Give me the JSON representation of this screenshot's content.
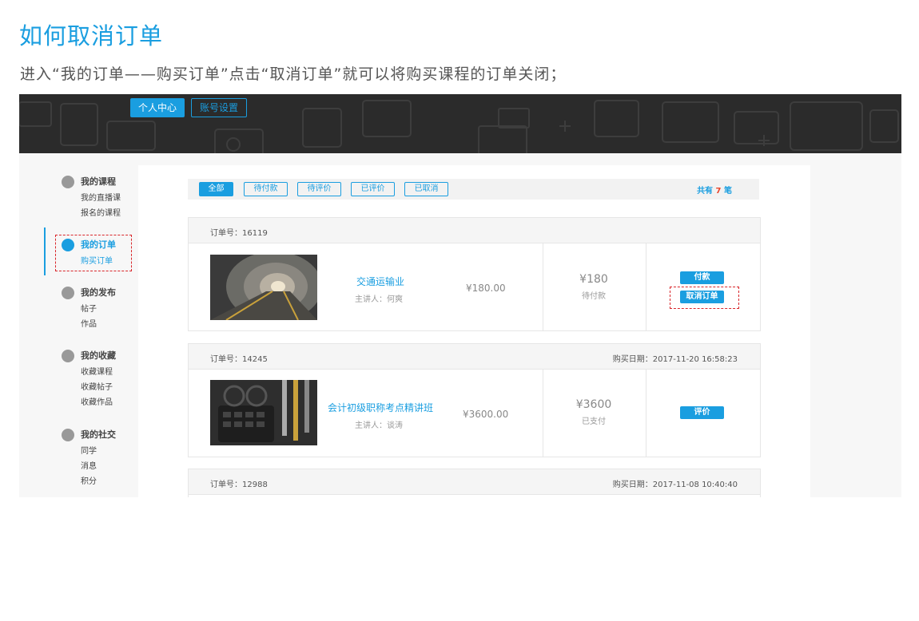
{
  "help": {
    "title": "如何取消订单",
    "description": "进入“我的订单——购买订单”点击“取消订单”就可以将购买课程的订单关闭；"
  },
  "header": {
    "tabs": [
      {
        "label": "个人中心",
        "active": true
      },
      {
        "label": "账号设置",
        "active": false
      }
    ]
  },
  "sidebar": {
    "groups": [
      {
        "icon": "book-icon",
        "title": "我的课程",
        "items": [
          "我的直播课",
          "报名的课程"
        ]
      },
      {
        "icon": "order-icon",
        "title": "我的订单",
        "items": [
          "购买订单"
        ],
        "active": true
      },
      {
        "icon": "send-icon",
        "title": "我的发布",
        "items": [
          "帖子",
          "作品"
        ]
      },
      {
        "icon": "star-icon",
        "title": "我的收藏",
        "items": [
          "收藏课程",
          "收藏帖子",
          "收藏作品"
        ]
      },
      {
        "icon": "chat-icon",
        "title": "我的社交",
        "items": [
          "同学",
          "消息",
          "积分"
        ]
      }
    ]
  },
  "filters": [
    "全部",
    "待付款",
    "待评价",
    "已评价",
    "已取消"
  ],
  "summary": {
    "prefix": "共有",
    "count": "7",
    "suffix": "笔"
  },
  "orders": [
    {
      "order_no": "订单号：16119",
      "date": "",
      "course": "交通运输业",
      "teacher": "主讲人：何爽",
      "price": "¥180.00",
      "amount": "¥180",
      "status": "待付款",
      "actions": [
        "付款",
        "取消订单"
      ]
    },
    {
      "order_no": "订单号：14245",
      "date": "购买日期：2017-11-20 16:58:23",
      "course": "会计初级职称考点精讲班",
      "teacher": "主讲人：谈涛",
      "price": "¥3600.00",
      "amount": "¥3600",
      "status": "已支付",
      "actions": [
        "评价"
      ]
    },
    {
      "order_no": "订单号：12988",
      "date": "购买日期：2017-11-08 10:40:40"
    }
  ],
  "colors": {
    "accent": "#1a9ee0",
    "highlight": "#d9262a",
    "header_bg": "#2b2b2b"
  }
}
